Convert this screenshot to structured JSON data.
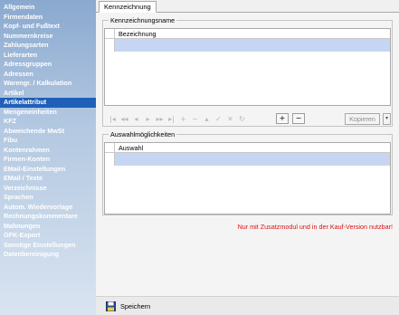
{
  "sidebar": {
    "items": [
      {
        "label": "Allgemein"
      },
      {
        "label": "Firmendaten"
      },
      {
        "label": "Kopf- und Fußtext"
      },
      {
        "label": "Nummernkreise"
      },
      {
        "label": "Zahlungsarten"
      },
      {
        "label": "Lieferarten"
      },
      {
        "label": "Adressgruppen"
      },
      {
        "label": "Adressen"
      },
      {
        "label": "Warengr. / Kalkulation"
      },
      {
        "label": "Artikel"
      },
      {
        "label": "Artikelattribut"
      },
      {
        "label": "Mengeneinheiten"
      },
      {
        "label": "KFZ"
      },
      {
        "label": "Abweichende MwSt"
      },
      {
        "label": "Fibu"
      },
      {
        "label": "Kontenrahmen"
      },
      {
        "label": "Firmen-Konten"
      },
      {
        "label": "EMail-Einstellungen"
      },
      {
        "label": "EMail / Texte"
      },
      {
        "label": "Verzeichnisse"
      },
      {
        "label": "Sprachen"
      },
      {
        "label": "Autom. Wiedervorlage"
      },
      {
        "label": "Rechnungskommentare"
      },
      {
        "label": "Mahnungen"
      },
      {
        "label": "GFK-Export"
      },
      {
        "label": "Sonstige Einstellungen"
      },
      {
        "label": "Datenbereinigung"
      }
    ],
    "active_index": 10
  },
  "tabs": [
    {
      "label": "Kennzeichnung"
    }
  ],
  "group1": {
    "title": "Kennzeichnungsname",
    "column": "Bezeichnung",
    "nav_icons": [
      "first-record-icon",
      "prev-page-icon",
      "prev-record-icon",
      "next-record-icon",
      "next-page-icon",
      "last-record-icon",
      "insert-icon",
      "delete-icon",
      "edit-icon",
      "post-icon",
      "cancel-icon",
      "refresh-icon"
    ],
    "nav_glyphs": [
      "|◂",
      "◂◂",
      "◂",
      "▸",
      "▸▸",
      "▸|",
      "+",
      "−",
      "▴",
      "✓",
      "✕",
      "↻"
    ],
    "add_label": "+",
    "remove_label": "−",
    "copy_label": "Kopieren",
    "copy_arrow": "▾"
  },
  "group2": {
    "title": "Auswahlmöglichkeiten",
    "column": "Auswahl"
  },
  "notice": "Nur mit Zusatzmodul und in der Kauf-Version nutzbar!",
  "bottom": {
    "save_label": "Speichern"
  },
  "colors": {
    "accent": "#1f5fb8",
    "selection": "#c6d6f2",
    "notice": "#e01010"
  }
}
